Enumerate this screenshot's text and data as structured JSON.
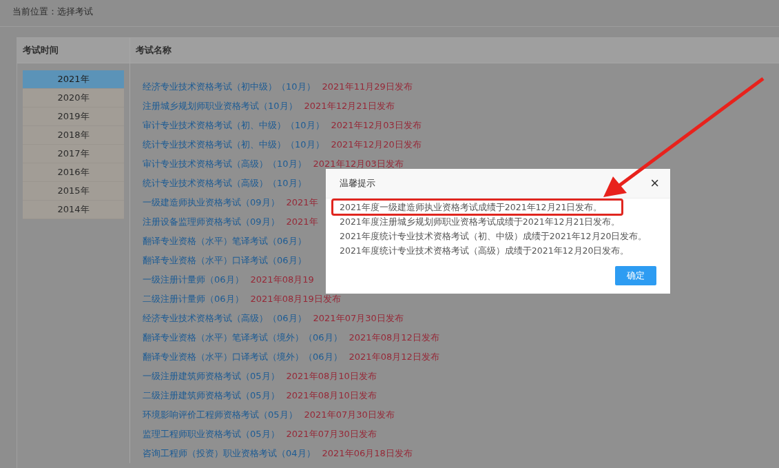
{
  "breadcrumb": "当前位置：选择考试",
  "table": {
    "columns": [
      "考试时间",
      "考试名称"
    ],
    "years": [
      {
        "label": "2021年",
        "selected": true
      },
      {
        "label": "2020年",
        "selected": false
      },
      {
        "label": "2019年",
        "selected": false
      },
      {
        "label": "2018年",
        "selected": false
      },
      {
        "label": "2017年",
        "selected": false
      },
      {
        "label": "2016年",
        "selected": false
      },
      {
        "label": "2015年",
        "selected": false
      },
      {
        "label": "2014年",
        "selected": false
      }
    ],
    "exams": [
      {
        "name": "经济专业技术资格考试（初中级）（10月）",
        "date": "2021年11月29日发布"
      },
      {
        "name": "注册城乡规划师职业资格考试（10月）",
        "date": "2021年12月21日发布"
      },
      {
        "name": "审计专业技术资格考试（初、中级）（10月）",
        "date": "2021年12月03日发布"
      },
      {
        "name": "统计专业技术资格考试（初、中级）（10月）",
        "date": "2021年12月20日发布"
      },
      {
        "name": "审计专业技术资格考试（高级）（10月）",
        "date": "2021年12月03日发布"
      },
      {
        "name": "统计专业技术资格考试（高级）（10月）"
      },
      {
        "name": "一级建造师执业资格考试（09月）",
        "date": "2021年"
      },
      {
        "name": "注册设备监理师资格考试（09月）",
        "date": "2021年"
      },
      {
        "name": "翻译专业资格（水平）笔译考试（06月）"
      },
      {
        "name": "翻译专业资格（水平）口译考试（06月）"
      },
      {
        "name": "一级注册计量师（06月）",
        "date": "2021年08月19"
      },
      {
        "name": "二级注册计量师（06月）",
        "date": "2021年08月19日发布"
      },
      {
        "name": "经济专业技术资格考试（高级）（06月）",
        "date": "2021年07月30日发布"
      },
      {
        "name": "翻译专业资格（水平）笔译考试（境外）（06月）",
        "date": "2021年08月12日发布"
      },
      {
        "name": "翻译专业资格（水平）口译考试（境外）（06月）",
        "date": "2021年08月12日发布"
      },
      {
        "name": "一级注册建筑师资格考试（05月）",
        "date": "2021年08月10日发布"
      },
      {
        "name": "二级注册建筑师资格考试（05月）",
        "date": "2021年08月10日发布"
      },
      {
        "name": "环境影响评价工程师资格考试（05月）",
        "date": "2021年07月30日发布"
      },
      {
        "name": "监理工程师职业资格考试（05月）",
        "date": "2021年07月30日发布"
      },
      {
        "name": "咨询工程师（投资）职业资格考试（04月）",
        "date": "2021年06月18日发布"
      }
    ]
  },
  "dialog": {
    "title": "温馨提示",
    "close": "×",
    "messages": [
      {
        "text": "2021年度一级建造师执业资格考试成绩于2021年12月21日发布。",
        "highlighted": true
      },
      {
        "text": "2021年度注册城乡规划师职业资格考试成绩于2021年12月21日发布。",
        "highlighted": false
      },
      {
        "text": "2021年度统计专业技术资格考试（初、中级）成绩于2021年12月20日发布。",
        "highlighted": false
      },
      {
        "text": "2021年度统计专业技术资格考试（高级）成绩于2021年12月20日发布。",
        "highlighted": false
      }
    ],
    "confirm": "确定"
  }
}
